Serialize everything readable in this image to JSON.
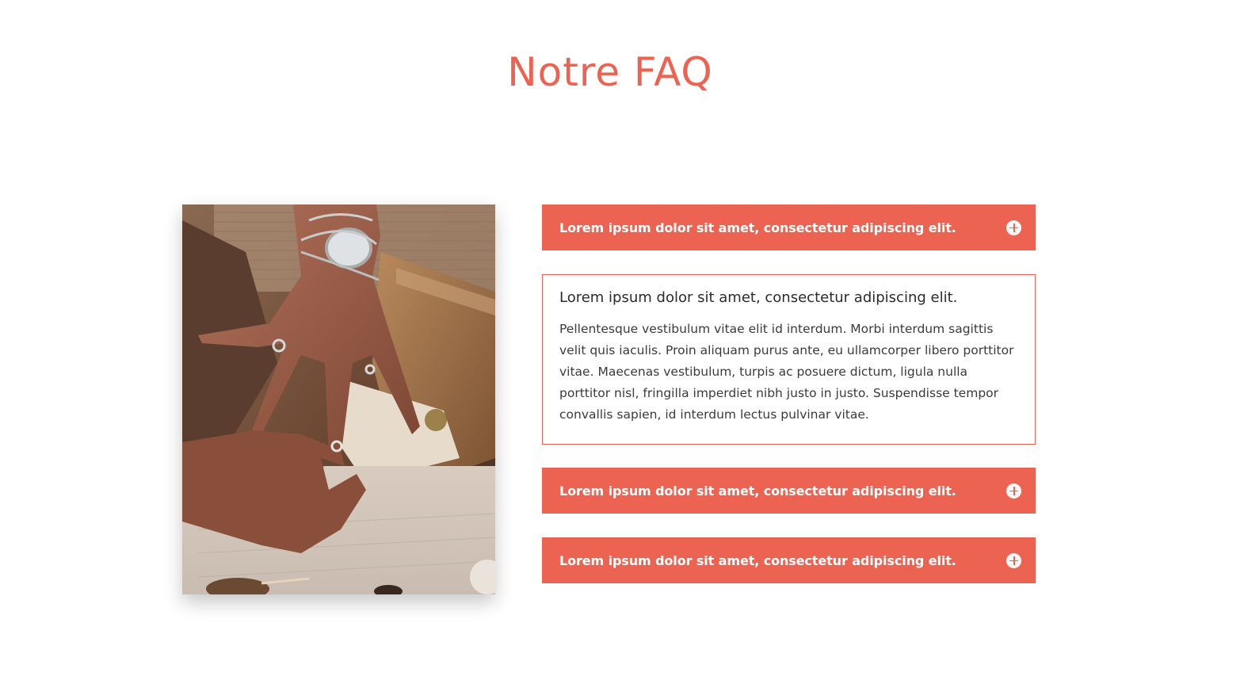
{
  "colors": {
    "accent": "#ec6351",
    "text_dark": "#2b2b2b",
    "background": "#ffffff"
  },
  "header": {
    "title": "Notre FAQ"
  },
  "image": {
    "alt": "Hands trying on silver rings"
  },
  "faq": {
    "items": [
      {
        "question": "Lorem ipsum dolor sit amet, consectetur adipiscing elit.",
        "expanded": false,
        "icon": "plus-circle-icon"
      },
      {
        "question": "Lorem ipsum dolor sit amet, consectetur adipiscing elit.",
        "answer": "Pellentesque vestibulum vitae elit id interdum. Morbi interdum sagittis velit quis iaculis. Proin aliquam purus ante, eu ullamcorper libero porttitor vitae. Maecenas vestibulum, turpis ac posuere dictum, ligula nulla porttitor nisl, fringilla imperdiet nibh justo in justo. Suspendisse tempor convallis sapien, id interdum lectus pulvinar vitae.",
        "expanded": true
      },
      {
        "question": "Lorem ipsum dolor sit amet, consectetur adipiscing elit.",
        "expanded": false,
        "icon": "plus-circle-icon"
      },
      {
        "question": "Lorem ipsum dolor sit amet, consectetur adipiscing elit.",
        "expanded": false,
        "icon": "plus-circle-icon"
      }
    ]
  }
}
